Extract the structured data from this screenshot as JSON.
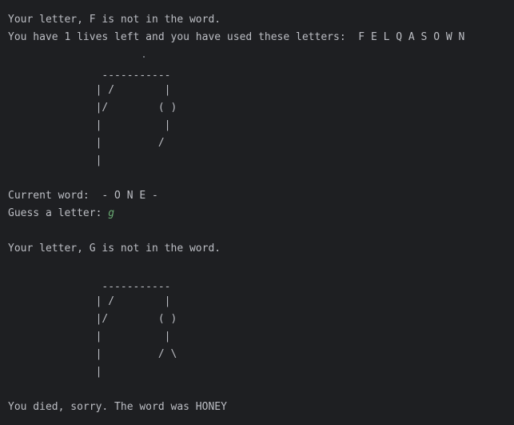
{
  "console": {
    "lines": [
      "Your letter, F is not in the word.",
      "You have 1 lives left and you have used these letters:  F E L Q A S O W N",
      "               -----------",
      "              | /        |",
      "              |/        ( )",
      "              |          |",
      "              |         /",
      "              |",
      "Current word:  - O N E -",
      "Guess a letter: ",
      "Your letter, G is not in the word.",
      "               -----------",
      "              | /        |",
      "              |/        ( )",
      "              |          |",
      "              |         / \\",
      "              |",
      "You died, sorry. The word was HONEY"
    ],
    "user_input": "g"
  },
  "colors": {
    "background": "#1e1f22",
    "text": "#bcbec4",
    "user_input": "#6aab73"
  }
}
